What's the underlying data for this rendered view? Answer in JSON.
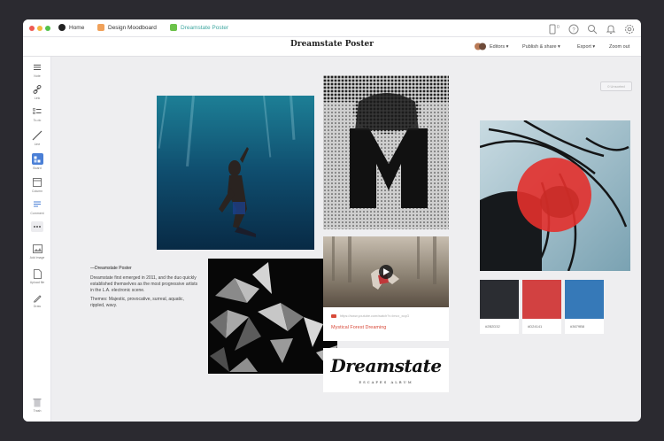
{
  "breadcrumbs": {
    "home": "Home",
    "moodboard": "Design Moodboard",
    "current": "Dreamstate Poster"
  },
  "topbar": {
    "device_count": "0"
  },
  "toolbar": {
    "title": "Dreamstate Poster",
    "editors": "Editors ▾",
    "publish": "Publish & share ▾",
    "export": "Export ▾",
    "zoom": "Zoom out"
  },
  "sidebar": {
    "items": [
      {
        "label": "Note",
        "icon": "note-icon"
      },
      {
        "label": "Link",
        "icon": "link-icon"
      },
      {
        "label": "To-do",
        "icon": "todo-icon"
      },
      {
        "label": "Line",
        "icon": "line-icon"
      },
      {
        "label": "Board",
        "icon": "board-icon"
      },
      {
        "label": "Column",
        "icon": "column-icon"
      },
      {
        "label": "Comment",
        "icon": "comment-icon"
      },
      {
        "label": "",
        "icon": "more-icon"
      },
      {
        "label": "Add image",
        "icon": "image-icon"
      },
      {
        "label": "Upload file",
        "icon": "upload-icon"
      },
      {
        "label": "Draw",
        "icon": "pen-icon"
      },
      {
        "label": "Trash",
        "icon": "trash-icon"
      }
    ]
  },
  "canvas": {
    "unsorted": "0 Unsorted",
    "note": {
      "title": "—Dreamstate Poster",
      "para1": "Dreamstate first emerged in 2011, and the duo quickly established themselves as the most progressive artists in the L.A. electronic scene.",
      "para2": "Themes: Majestic, provocative, surreal, aquatic, rippled, wavy."
    },
    "video": {
      "url": "https://www.youtube.com/watch?v=lmcx_xuyG",
      "title": "Mystical Forest Dreaming"
    },
    "logo": {
      "main": "Dreamstate",
      "sub": "ESCAPES ALBUM"
    },
    "swatches": [
      {
        "hex": "#2B2D32",
        "color": "#2b2d32"
      },
      {
        "hex": "#D24141",
        "color": "#d24141"
      },
      {
        "hex": "#3679B8",
        "color": "#3679b8"
      }
    ]
  },
  "colors": {
    "accent_teal": "#3fa7a0",
    "board_blue": "#4a7fd6",
    "video_red": "#d84a3a"
  }
}
